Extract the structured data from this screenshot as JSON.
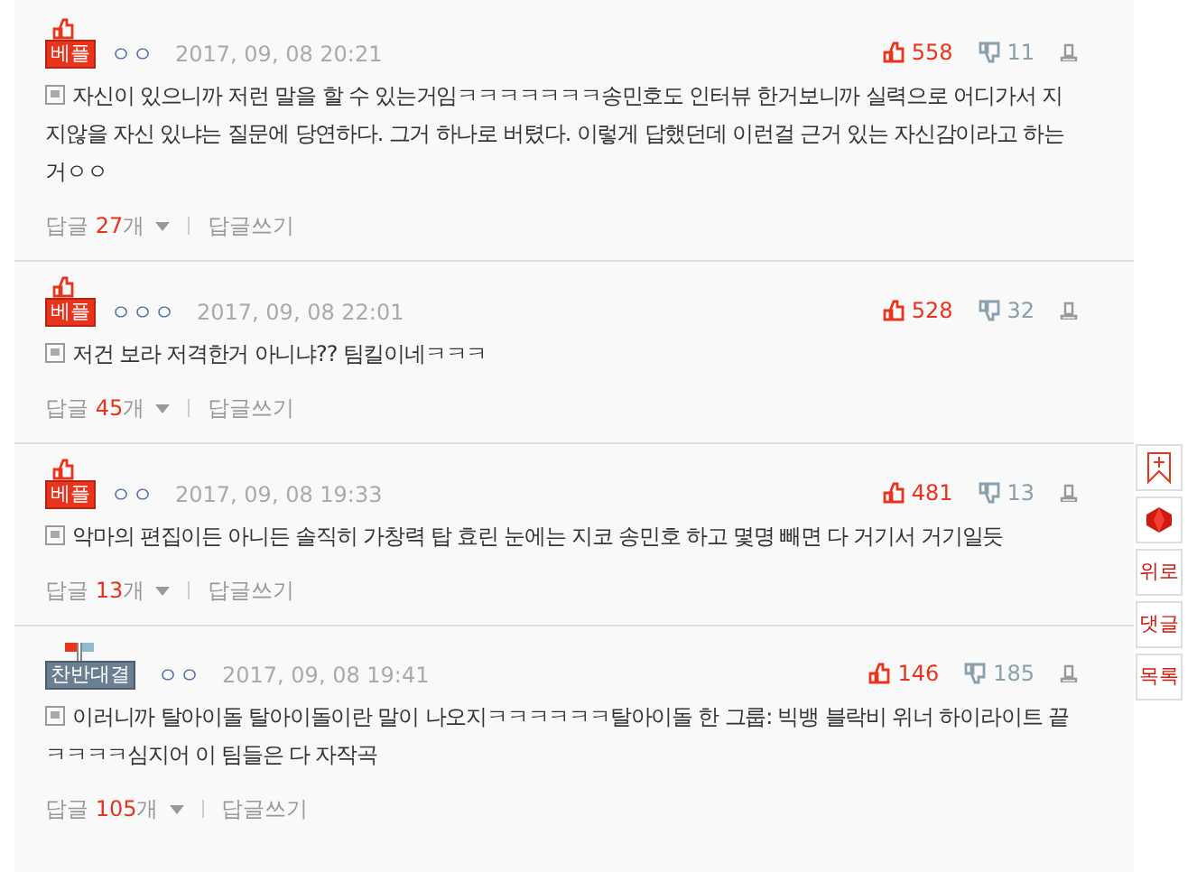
{
  "comments": [
    {
      "badge": {
        "kind": "best",
        "label": "베플"
      },
      "author": "ㅇㅇ",
      "date": "2017, 09, 08 20:21",
      "likes": "558",
      "dislikes": "11",
      "text": "자신이 있으니까 저런 말을 할 수 있는거임ㅋㅋㅋㅋㅋㅋㅋ송민호도 인터뷰 한거보니까 실력으로 어디가서 지지않을 자신 있냐는 질문에 당연하다. 그거 하나로 버텼다. 이렇게 답했던데 이런걸 근거 있는 자신감이라고 하는거ㅇㅇ",
      "reply_label": "답글",
      "reply_count": "27",
      "reply_unit": "개",
      "write_reply": "답글쓰기"
    },
    {
      "badge": {
        "kind": "best",
        "label": "베플"
      },
      "author": "ㅇㅇㅇ",
      "date": "2017, 09, 08 22:01",
      "likes": "528",
      "dislikes": "32",
      "text": "저건 보라 저격한거 아니냐?? 팀킬이네ㅋㅋㅋ",
      "reply_label": "답글",
      "reply_count": "45",
      "reply_unit": "개",
      "write_reply": "답글쓰기"
    },
    {
      "badge": {
        "kind": "best",
        "label": "베플"
      },
      "author": "ㅇㅇ",
      "date": "2017, 09, 08 19:33",
      "likes": "481",
      "dislikes": "13",
      "text": "악마의 편집이든 아니든 솔직히 가창력 탑 효린 눈에는 지코 송민호 하고 몇명 빼면 다 거기서 거기일듯",
      "reply_label": "답글",
      "reply_count": "13",
      "reply_unit": "개",
      "write_reply": "답글쓰기"
    },
    {
      "badge": {
        "kind": "versus",
        "label": "찬반대결"
      },
      "author": "ㅇㅇ",
      "date": "2017, 09, 08 19:41",
      "likes": "146",
      "dislikes": "185",
      "text": "이러니까 탈아이돌 탈아이돌이란 말이 나오지ㅋㅋㅋㅋㅋㅋ탈아이돌 한 그룹: 빅뱅 블락비 위너 하이라이트 끝 ㅋㅋㅋㅋ심지어 이 팀들은 다 자작곡",
      "reply_label": "답글",
      "reply_count": "105",
      "reply_unit": "개",
      "write_reply": "답글쓰기"
    }
  ],
  "side_buttons": [
    {
      "kind": "bookmark"
    },
    {
      "kind": "gem"
    },
    {
      "kind": "text",
      "label": "위로"
    },
    {
      "kind": "text",
      "label": "댓글"
    },
    {
      "kind": "text",
      "label": "목록"
    }
  ]
}
